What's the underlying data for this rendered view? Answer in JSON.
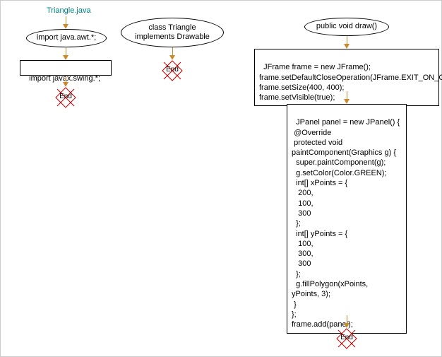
{
  "col1": {
    "title": "Triangle.java",
    "box1": "import java.awt.*;",
    "box2": "import javax.swing.*;",
    "end": "End"
  },
  "col2": {
    "ellipse": "class Triangle\nimplements Drawable",
    "end": "End"
  },
  "col3": {
    "ellipse": "public void draw()",
    "box1": "JFrame frame = new JFrame();\nframe.setDefaultCloseOperation(JFrame.EXIT_ON_CLOSE);\nframe.setSize(400, 400);\nframe.setVisible(true);",
    "box2": "JPanel panel = new JPanel() {\n @Override\n protected void\npaintComponent(Graphics g) {\n  super.paintComponent(g);\n  g.setColor(Color.GREEN);\n  int[] xPoints = {\n   200,\n   100,\n   300\n  };\n  int[] yPoints = {\n   100,\n   300,\n   300\n  };\n  g.fillPolygon(xPoints,\nyPoints, 3);\n }\n};\nframe.add(panel);",
    "end": "End"
  }
}
